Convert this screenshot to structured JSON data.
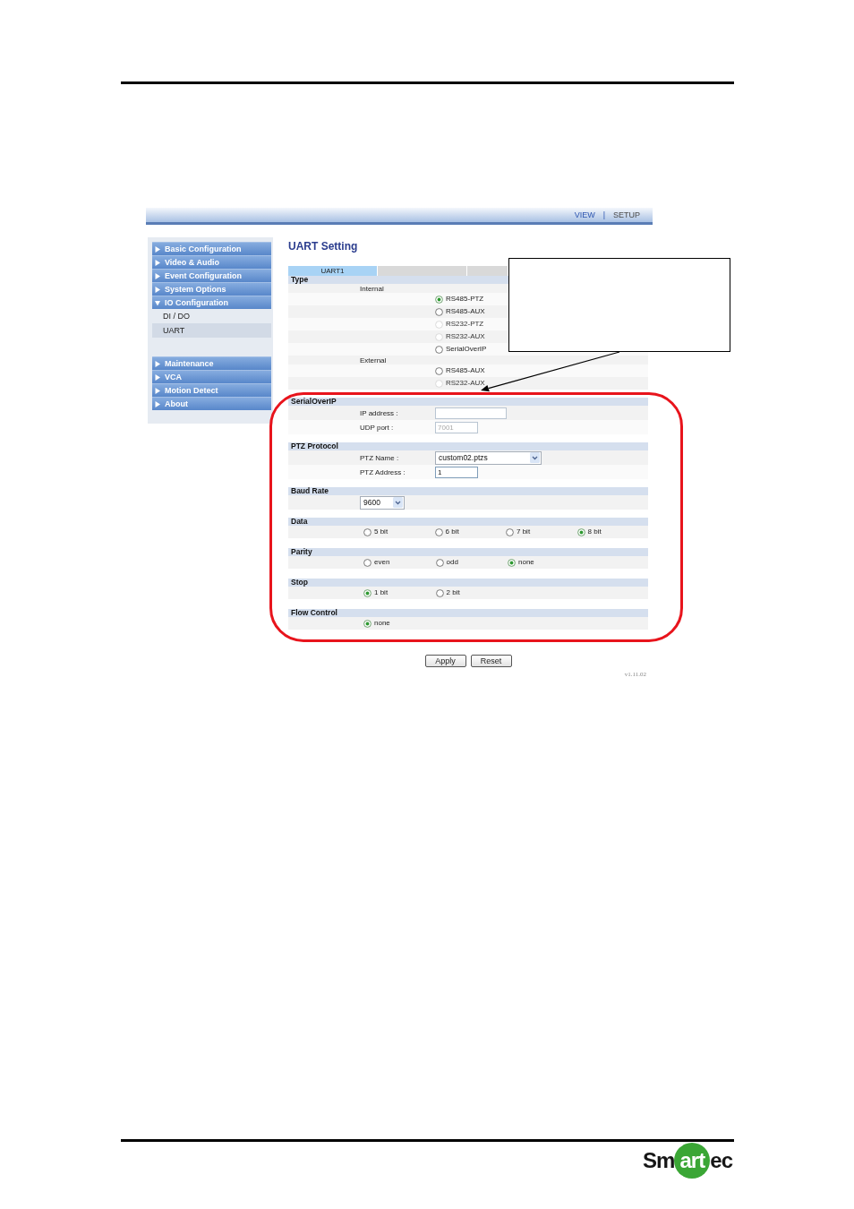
{
  "screenshot": {
    "top_nav": {
      "links": [
        {
          "label": "VIEW",
          "selected": false
        },
        {
          "label": "SETUP",
          "selected": true
        }
      ],
      "separator": "|"
    },
    "sidebar": {
      "items": [
        {
          "label": "Basic Configuration",
          "expanded": false
        },
        {
          "label": "Video & Audio",
          "expanded": false
        },
        {
          "label": "Event Configuration",
          "expanded": false
        },
        {
          "label": "System Options",
          "expanded": false
        },
        {
          "label": "IO Configuration",
          "expanded": true,
          "children": [
            {
              "label": "DI / DO",
              "selected": false
            },
            {
              "label": "UART",
              "selected": true
            }
          ]
        },
        {
          "label": "Maintenance",
          "expanded": false
        },
        {
          "label": "VCA",
          "expanded": false
        },
        {
          "label": "Motion Detect",
          "expanded": false
        },
        {
          "label": "About",
          "expanded": false
        }
      ]
    },
    "page_title": "UART Setting",
    "tabs": [
      {
        "label": "UART1",
        "selected": true
      },
      {
        "selected": false
      },
      {
        "selected": false
      }
    ],
    "sections": [
      {
        "title": "Type",
        "kind": "radio_list",
        "groups": [
          {
            "label": "Internal",
            "options": [
              {
                "label": "RS485-PTZ",
                "selected": true,
                "disabled": false
              },
              {
                "label": "RS485-AUX",
                "selected": false,
                "disabled": false
              },
              {
                "label": "RS232-PTZ",
                "selected": false,
                "disabled": true
              },
              {
                "label": "RS232-AUX",
                "selected": false,
                "disabled": true
              },
              {
                "label": "SerialOverIP",
                "selected": false,
                "disabled": false
              }
            ]
          },
          {
            "label": "External",
            "options": [
              {
                "label": "RS485-AUX",
                "selected": false,
                "disabled": false
              },
              {
                "label": "RS232-AUX",
                "selected": false,
                "disabled": true
              }
            ]
          }
        ]
      },
      {
        "title": "SerialOverIP",
        "kind": "fields",
        "fields": [
          {
            "label": "IP address :",
            "kind": "text",
            "disabled": true
          },
          {
            "label": "UDP port :",
            "kind": "text",
            "value": "7001",
            "disabled": true
          }
        ]
      },
      {
        "title": "PTZ Protocol",
        "kind": "fields",
        "fields": [
          {
            "label": "PTZ Name :",
            "kind": "select",
            "value": "custom02.ptzs",
            "disabled": false
          },
          {
            "label": "PTZ Address :",
            "kind": "text",
            "value": "1",
            "disabled": false
          }
        ]
      },
      {
        "title": "Baud Rate",
        "kind": "fields",
        "fields": [
          {
            "kind": "select",
            "value": "9600",
            "disabled": false
          }
        ]
      },
      {
        "title": "Data",
        "kind": "radio_row",
        "options": [
          {
            "label": "5 bit",
            "selected": false
          },
          {
            "label": "6 bit",
            "selected": false
          },
          {
            "label": "7 bit",
            "selected": false
          },
          {
            "label": "8 bit",
            "selected": true
          }
        ]
      },
      {
        "title": "Parity",
        "kind": "radio_row",
        "options": [
          {
            "label": "even",
            "selected": false
          },
          {
            "label": "odd",
            "selected": false
          },
          {
            "label": "none",
            "selected": true
          }
        ]
      },
      {
        "title": "Stop",
        "kind": "radio_row",
        "options": [
          {
            "label": "1 bit",
            "selected": true
          },
          {
            "label": "2 bit",
            "selected": false
          }
        ]
      },
      {
        "title": "Flow Control",
        "kind": "radio_row",
        "options": [
          {
            "label": "none",
            "selected": true
          }
        ]
      }
    ],
    "buttons": [
      {
        "label": "Apply"
      },
      {
        "label": "Reset"
      }
    ],
    "version": "v1.11.02"
  },
  "logo": {
    "parts": [
      "Sm",
      "art",
      "ec"
    ]
  }
}
